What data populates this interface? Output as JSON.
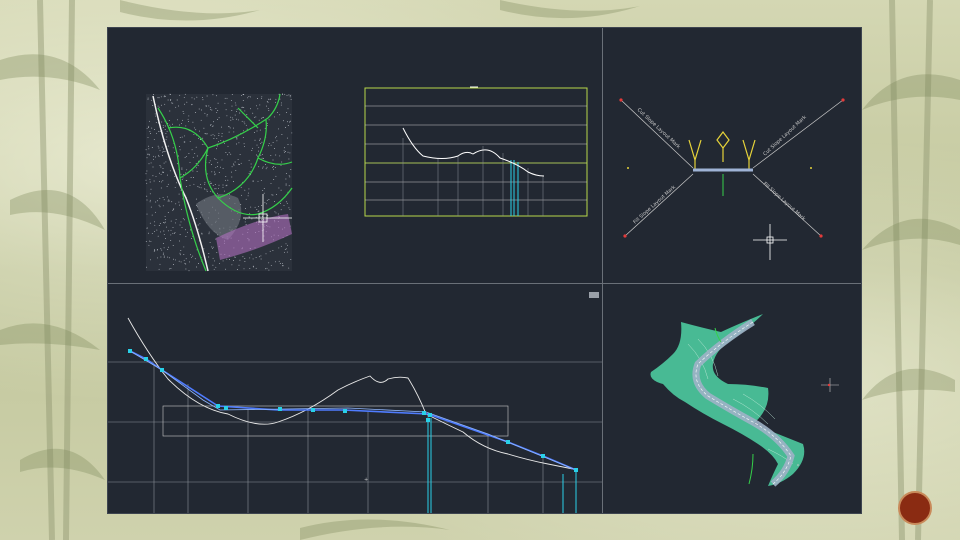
{
  "slide": {
    "number": ""
  },
  "viewports": {
    "top_right": {
      "labels": {
        "cut_left": "Cut Slope Layout Mark",
        "cut_right": "Cut Slope Layout Mark",
        "fill_left": "Fill Slope Layout Mark",
        "fill_right": "Fill Slope Layout Mark"
      }
    }
  },
  "colors": {
    "background": "#c9cda6",
    "viewport_bg": "#222832",
    "profile_line": "#4f7cff",
    "profile_points": "#29d0e8",
    "alignment": "#35d14a",
    "surface_fill": "#4fd3a6",
    "badge": "#8a2b12"
  }
}
